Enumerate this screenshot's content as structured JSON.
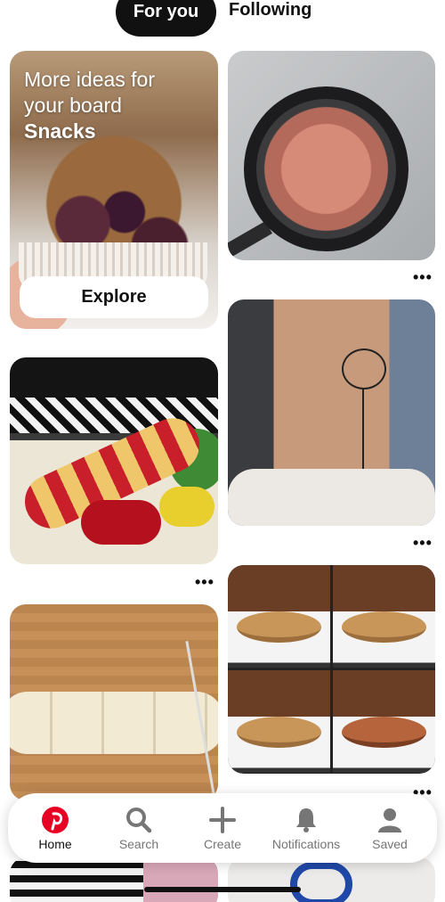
{
  "tabs": [
    {
      "label": "For you",
      "active": true
    },
    {
      "label": "Following",
      "active": false
    }
  ],
  "board_suggestion": {
    "line1": "More ideas for",
    "line2": "your board",
    "board_name": "Snacks",
    "explore_label": "Explore"
  },
  "more_options": "•••",
  "navigation": {
    "items": [
      {
        "label": "Home",
        "icon": "pinterest-logo-icon",
        "active": true
      },
      {
        "label": "Search",
        "icon": "search-icon",
        "active": false
      },
      {
        "label": "Create",
        "icon": "plus-icon",
        "active": false
      },
      {
        "label": "Notifications",
        "icon": "bell-icon",
        "active": false
      },
      {
        "label": "Saved",
        "icon": "person-icon",
        "active": false
      }
    ]
  },
  "colors": {
    "brand": "#e60023",
    "active_tab_bg": "#111111",
    "inactive_icon": "#767676"
  }
}
